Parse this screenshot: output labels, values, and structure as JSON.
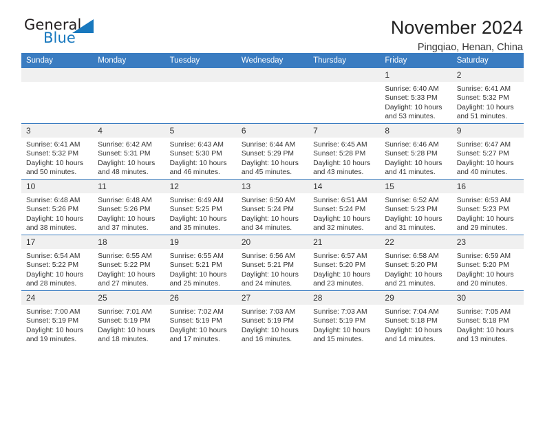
{
  "logo": {
    "word_one": "General",
    "word_two": "Blue",
    "triangle_icon": "triangle-icon"
  },
  "header": {
    "title": "November 2024",
    "location": "Pingqiao, Henan, China"
  },
  "colors": {
    "header_blue": "#3a7cc1",
    "logo_blue": "#1878be",
    "daynum_band": "#f0f0f0",
    "text": "#333333"
  },
  "calendar": {
    "weekday_headers": [
      "Sunday",
      "Monday",
      "Tuesday",
      "Wednesday",
      "Thursday",
      "Friday",
      "Saturday"
    ],
    "labels": {
      "sunrise": "Sunrise:",
      "sunset": "Sunset:",
      "daylight": "Daylight:"
    },
    "weeks": [
      [
        {
          "day": "",
          "empty": true
        },
        {
          "day": "",
          "empty": true
        },
        {
          "day": "",
          "empty": true
        },
        {
          "day": "",
          "empty": true
        },
        {
          "day": "",
          "empty": true
        },
        {
          "day": "1",
          "sunrise": "Sunrise: 6:40 AM",
          "sunset": "Sunset: 5:33 PM",
          "daylight": "Daylight: 10 hours and 53 minutes."
        },
        {
          "day": "2",
          "sunrise": "Sunrise: 6:41 AM",
          "sunset": "Sunset: 5:32 PM",
          "daylight": "Daylight: 10 hours and 51 minutes."
        }
      ],
      [
        {
          "day": "3",
          "sunrise": "Sunrise: 6:41 AM",
          "sunset": "Sunset: 5:32 PM",
          "daylight": "Daylight: 10 hours and 50 minutes."
        },
        {
          "day": "4",
          "sunrise": "Sunrise: 6:42 AM",
          "sunset": "Sunset: 5:31 PM",
          "daylight": "Daylight: 10 hours and 48 minutes."
        },
        {
          "day": "5",
          "sunrise": "Sunrise: 6:43 AM",
          "sunset": "Sunset: 5:30 PM",
          "daylight": "Daylight: 10 hours and 46 minutes."
        },
        {
          "day": "6",
          "sunrise": "Sunrise: 6:44 AM",
          "sunset": "Sunset: 5:29 PM",
          "daylight": "Daylight: 10 hours and 45 minutes."
        },
        {
          "day": "7",
          "sunrise": "Sunrise: 6:45 AM",
          "sunset": "Sunset: 5:28 PM",
          "daylight": "Daylight: 10 hours and 43 minutes."
        },
        {
          "day": "8",
          "sunrise": "Sunrise: 6:46 AM",
          "sunset": "Sunset: 5:28 PM",
          "daylight": "Daylight: 10 hours and 41 minutes."
        },
        {
          "day": "9",
          "sunrise": "Sunrise: 6:47 AM",
          "sunset": "Sunset: 5:27 PM",
          "daylight": "Daylight: 10 hours and 40 minutes."
        }
      ],
      [
        {
          "day": "10",
          "sunrise": "Sunrise: 6:48 AM",
          "sunset": "Sunset: 5:26 PM",
          "daylight": "Daylight: 10 hours and 38 minutes."
        },
        {
          "day": "11",
          "sunrise": "Sunrise: 6:48 AM",
          "sunset": "Sunset: 5:26 PM",
          "daylight": "Daylight: 10 hours and 37 minutes."
        },
        {
          "day": "12",
          "sunrise": "Sunrise: 6:49 AM",
          "sunset": "Sunset: 5:25 PM",
          "daylight": "Daylight: 10 hours and 35 minutes."
        },
        {
          "day": "13",
          "sunrise": "Sunrise: 6:50 AM",
          "sunset": "Sunset: 5:24 PM",
          "daylight": "Daylight: 10 hours and 34 minutes."
        },
        {
          "day": "14",
          "sunrise": "Sunrise: 6:51 AM",
          "sunset": "Sunset: 5:24 PM",
          "daylight": "Daylight: 10 hours and 32 minutes."
        },
        {
          "day": "15",
          "sunrise": "Sunrise: 6:52 AM",
          "sunset": "Sunset: 5:23 PM",
          "daylight": "Daylight: 10 hours and 31 minutes."
        },
        {
          "day": "16",
          "sunrise": "Sunrise: 6:53 AM",
          "sunset": "Sunset: 5:23 PM",
          "daylight": "Daylight: 10 hours and 29 minutes."
        }
      ],
      [
        {
          "day": "17",
          "sunrise": "Sunrise: 6:54 AM",
          "sunset": "Sunset: 5:22 PM",
          "daylight": "Daylight: 10 hours and 28 minutes."
        },
        {
          "day": "18",
          "sunrise": "Sunrise: 6:55 AM",
          "sunset": "Sunset: 5:22 PM",
          "daylight": "Daylight: 10 hours and 27 minutes."
        },
        {
          "day": "19",
          "sunrise": "Sunrise: 6:55 AM",
          "sunset": "Sunset: 5:21 PM",
          "daylight": "Daylight: 10 hours and 25 minutes."
        },
        {
          "day": "20",
          "sunrise": "Sunrise: 6:56 AM",
          "sunset": "Sunset: 5:21 PM",
          "daylight": "Daylight: 10 hours and 24 minutes."
        },
        {
          "day": "21",
          "sunrise": "Sunrise: 6:57 AM",
          "sunset": "Sunset: 5:20 PM",
          "daylight": "Daylight: 10 hours and 23 minutes."
        },
        {
          "day": "22",
          "sunrise": "Sunrise: 6:58 AM",
          "sunset": "Sunset: 5:20 PM",
          "daylight": "Daylight: 10 hours and 21 minutes."
        },
        {
          "day": "23",
          "sunrise": "Sunrise: 6:59 AM",
          "sunset": "Sunset: 5:20 PM",
          "daylight": "Daylight: 10 hours and 20 minutes."
        }
      ],
      [
        {
          "day": "24",
          "sunrise": "Sunrise: 7:00 AM",
          "sunset": "Sunset: 5:19 PM",
          "daylight": "Daylight: 10 hours and 19 minutes."
        },
        {
          "day": "25",
          "sunrise": "Sunrise: 7:01 AM",
          "sunset": "Sunset: 5:19 PM",
          "daylight": "Daylight: 10 hours and 18 minutes."
        },
        {
          "day": "26",
          "sunrise": "Sunrise: 7:02 AM",
          "sunset": "Sunset: 5:19 PM",
          "daylight": "Daylight: 10 hours and 17 minutes."
        },
        {
          "day": "27",
          "sunrise": "Sunrise: 7:03 AM",
          "sunset": "Sunset: 5:19 PM",
          "daylight": "Daylight: 10 hours and 16 minutes."
        },
        {
          "day": "28",
          "sunrise": "Sunrise: 7:03 AM",
          "sunset": "Sunset: 5:19 PM",
          "daylight": "Daylight: 10 hours and 15 minutes."
        },
        {
          "day": "29",
          "sunrise": "Sunrise: 7:04 AM",
          "sunset": "Sunset: 5:18 PM",
          "daylight": "Daylight: 10 hours and 14 minutes."
        },
        {
          "day": "30",
          "sunrise": "Sunrise: 7:05 AM",
          "sunset": "Sunset: 5:18 PM",
          "daylight": "Daylight: 10 hours and 13 minutes."
        }
      ]
    ]
  }
}
